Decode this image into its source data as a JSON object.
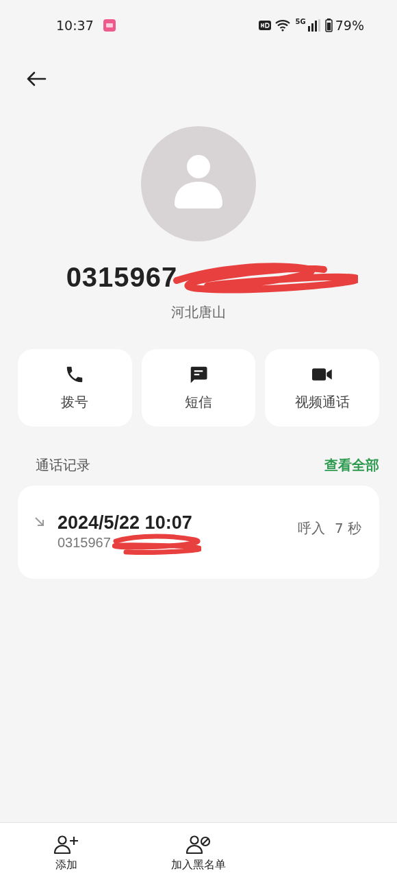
{
  "status_bar": {
    "time": "10:37",
    "network": "5G",
    "battery": "79%"
  },
  "contact": {
    "number": "0315967",
    "location": "河北唐山",
    "redacted": true
  },
  "actions": [
    {
      "kind": "call",
      "label": "拨号"
    },
    {
      "kind": "message",
      "label": "短信"
    },
    {
      "kind": "video",
      "label": "视频通话"
    }
  ],
  "call_log": {
    "title": "通话记录",
    "view_all": "查看全部",
    "entries": [
      {
        "kind": "incoming",
        "datetime": "2024/5/22 10:07",
        "number": "0315967",
        "redacted": true,
        "type": "呼入",
        "duration": "7 秒"
      }
    ]
  },
  "bottom_bar": [
    {
      "kind": "add",
      "label": "添加"
    },
    {
      "kind": "block",
      "label": "加入黑名单"
    }
  ]
}
